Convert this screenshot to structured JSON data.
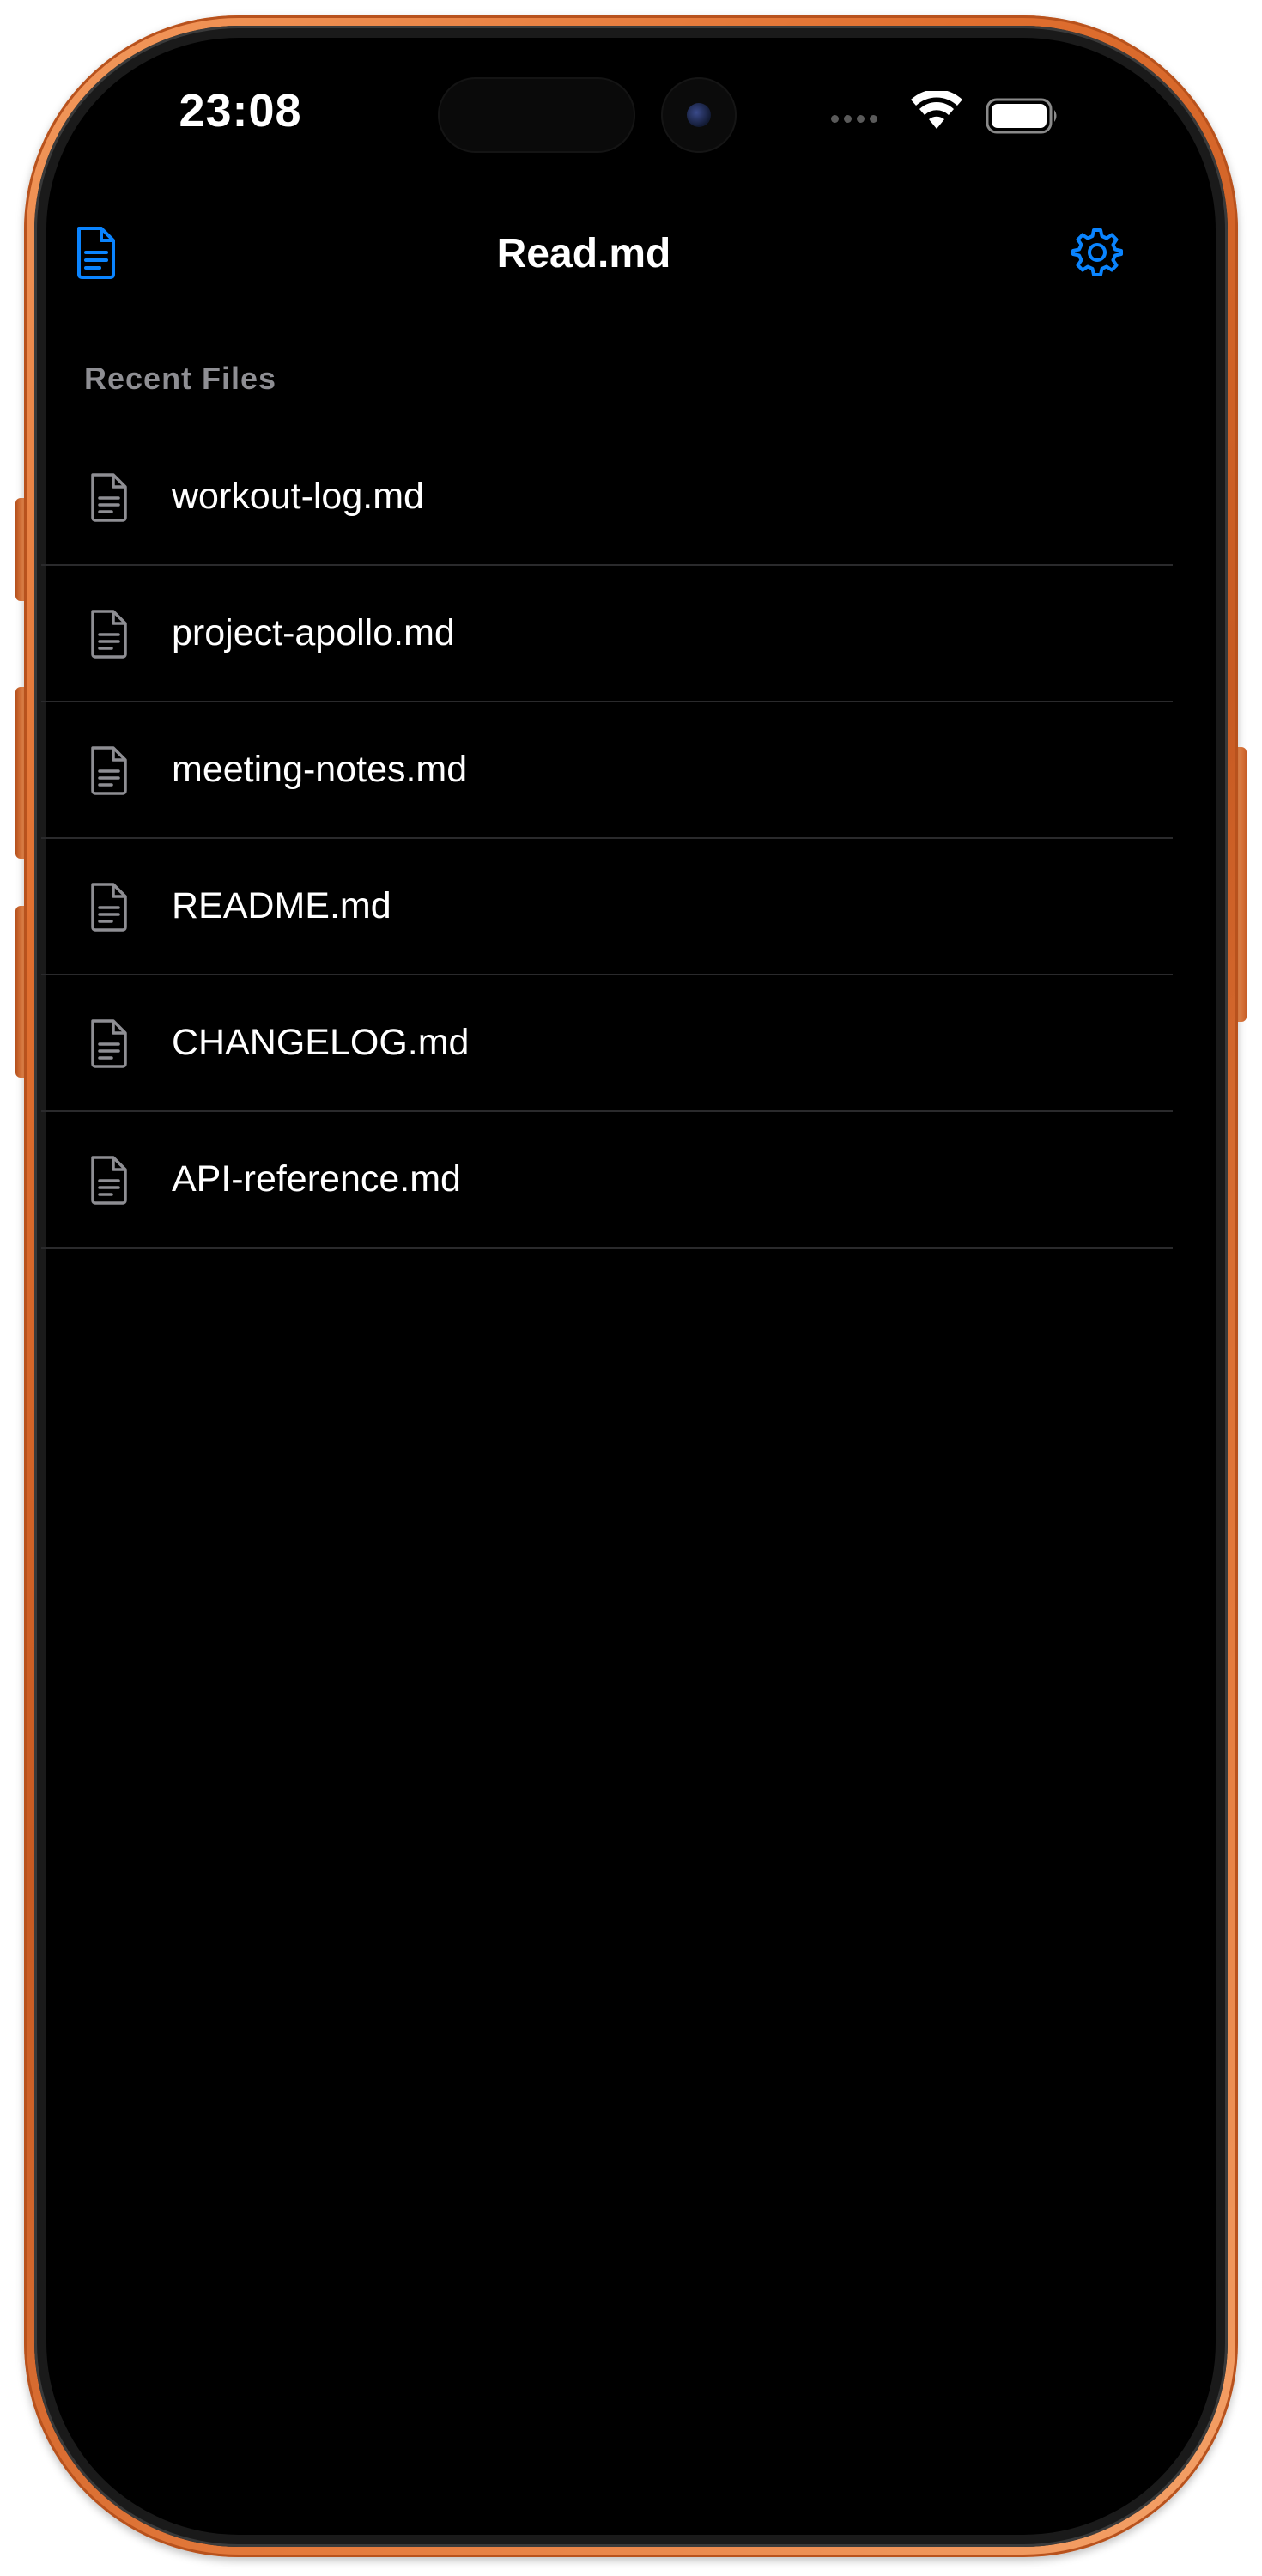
{
  "status_bar": {
    "time": "23:08"
  },
  "nav": {
    "title": "Read.md",
    "left_icon": "document-icon",
    "right_icon": "gear-icon"
  },
  "recent": {
    "header": "Recent Files",
    "files": [
      {
        "name": "workout-log.md"
      },
      {
        "name": "project-apollo.md"
      },
      {
        "name": "meeting-notes.md"
      },
      {
        "name": "README.md"
      },
      {
        "name": "CHANGELOG.md"
      },
      {
        "name": "API-reference.md"
      }
    ]
  },
  "colors": {
    "accent": "#0a84ff",
    "background": "#000000",
    "separator": "#2a2a2c",
    "secondary_text": "#8e8e93",
    "device_frame": "#e06f2f"
  }
}
